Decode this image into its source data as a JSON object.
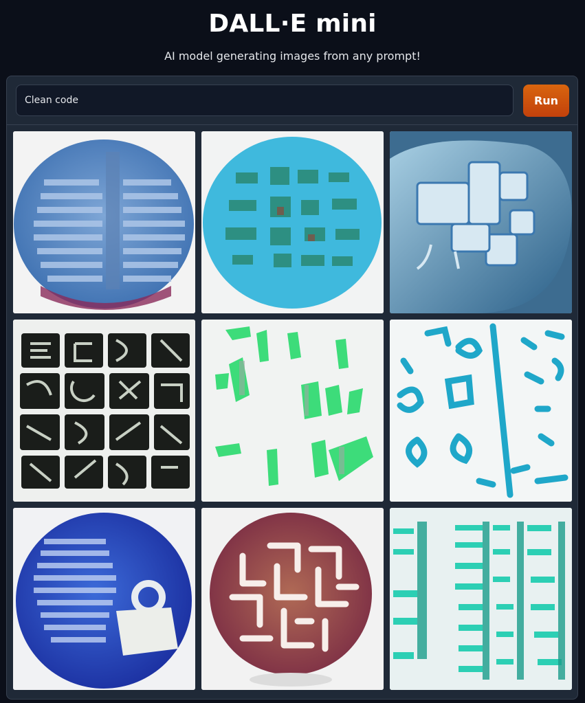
{
  "header": {
    "title": "DALL·E mini",
    "subtitle": "AI model generating images from any prompt!"
  },
  "prompt": {
    "value": "Clean code",
    "run_label": "Run"
  },
  "colors": {
    "background": "#0b0f19",
    "panel": "#1f2937",
    "input": "#111827",
    "run_button": "#c2410c"
  },
  "gallery": {
    "images": [
      {
        "description": "blue-disc-with-code-bars"
      },
      {
        "description": "cyan-disc-with-blocks"
      },
      {
        "description": "blue-machine-with-icons"
      },
      {
        "description": "black-letter-tiles"
      },
      {
        "description": "green-glyphs-on-white"
      },
      {
        "description": "cyan-symbols-on-white"
      },
      {
        "description": "dark-blue-disc-with-lock"
      },
      {
        "description": "brown-disc-maze"
      },
      {
        "description": "teal-stacked-bars"
      }
    ]
  }
}
